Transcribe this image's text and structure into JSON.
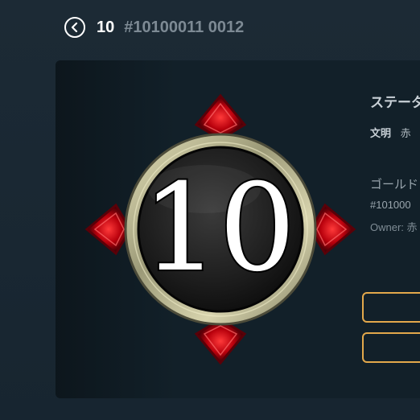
{
  "header": {
    "back_icon": "chevron-left-circle-icon",
    "title": "10",
    "token_id": "#10100011 0012"
  },
  "badge": {
    "numeral": "10",
    "colors": {
      "gem": "#c0101a",
      "ring": "#c9c49a",
      "disc": "#1e1e1e"
    }
  },
  "info": {
    "status_title": "ステータ",
    "civ_label": "文明",
    "civ_value": "赤",
    "gold_name": "ゴールド",
    "token_id": "#101000",
    "owner": "Owner: 赤"
  },
  "buttons": [
    {
      "label": ""
    },
    {
      "label": ""
    }
  ],
  "colors": {
    "accent": "#e3a84b",
    "background": "#182630"
  }
}
